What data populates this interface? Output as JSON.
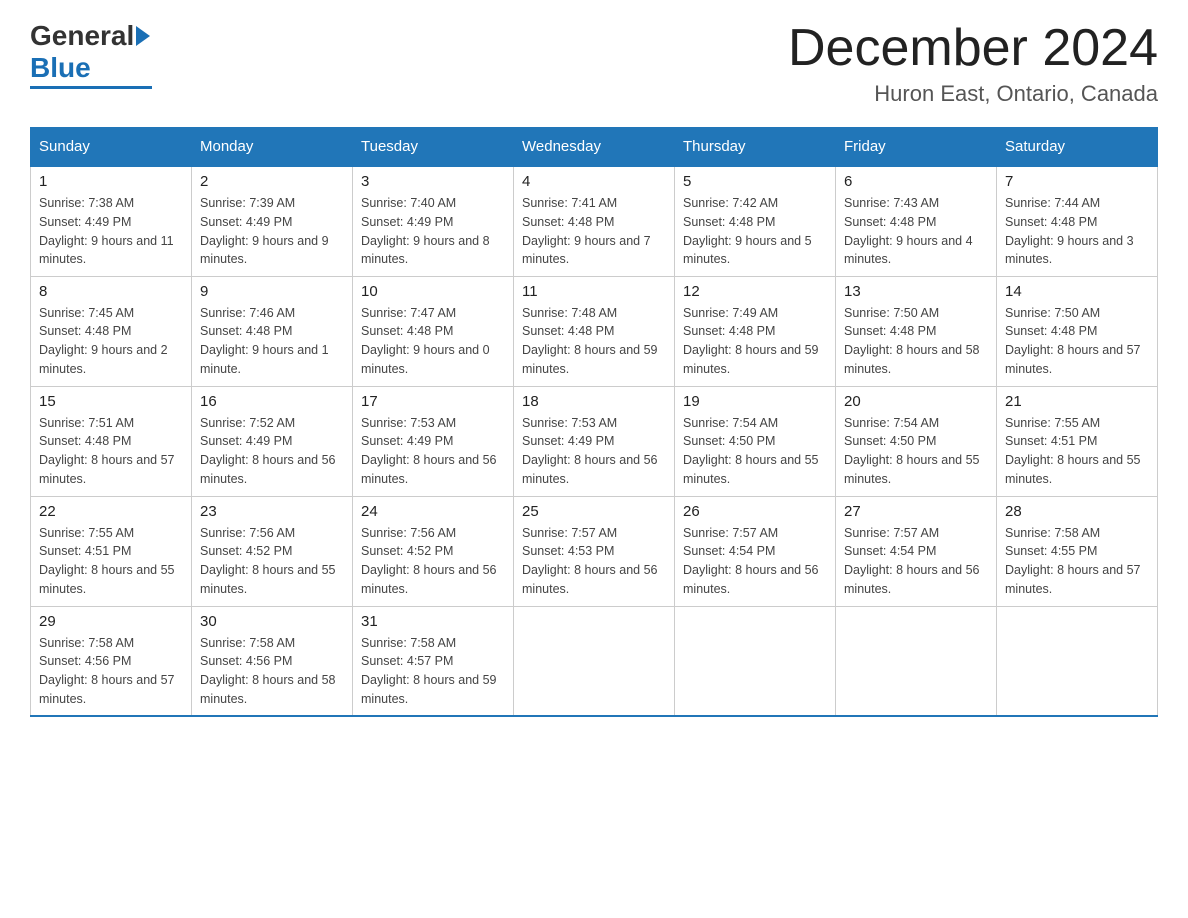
{
  "logo": {
    "general": "General",
    "blue": "Blue"
  },
  "header": {
    "month": "December 2024",
    "location": "Huron East, Ontario, Canada"
  },
  "weekdays": [
    "Sunday",
    "Monday",
    "Tuesday",
    "Wednesday",
    "Thursday",
    "Friday",
    "Saturday"
  ],
  "weeks": [
    [
      {
        "day": "1",
        "sunrise": "Sunrise: 7:38 AM",
        "sunset": "Sunset: 4:49 PM",
        "daylight": "Daylight: 9 hours and 11 minutes."
      },
      {
        "day": "2",
        "sunrise": "Sunrise: 7:39 AM",
        "sunset": "Sunset: 4:49 PM",
        "daylight": "Daylight: 9 hours and 9 minutes."
      },
      {
        "day": "3",
        "sunrise": "Sunrise: 7:40 AM",
        "sunset": "Sunset: 4:49 PM",
        "daylight": "Daylight: 9 hours and 8 minutes."
      },
      {
        "day": "4",
        "sunrise": "Sunrise: 7:41 AM",
        "sunset": "Sunset: 4:48 PM",
        "daylight": "Daylight: 9 hours and 7 minutes."
      },
      {
        "day": "5",
        "sunrise": "Sunrise: 7:42 AM",
        "sunset": "Sunset: 4:48 PM",
        "daylight": "Daylight: 9 hours and 5 minutes."
      },
      {
        "day": "6",
        "sunrise": "Sunrise: 7:43 AM",
        "sunset": "Sunset: 4:48 PM",
        "daylight": "Daylight: 9 hours and 4 minutes."
      },
      {
        "day": "7",
        "sunrise": "Sunrise: 7:44 AM",
        "sunset": "Sunset: 4:48 PM",
        "daylight": "Daylight: 9 hours and 3 minutes."
      }
    ],
    [
      {
        "day": "8",
        "sunrise": "Sunrise: 7:45 AM",
        "sunset": "Sunset: 4:48 PM",
        "daylight": "Daylight: 9 hours and 2 minutes."
      },
      {
        "day": "9",
        "sunrise": "Sunrise: 7:46 AM",
        "sunset": "Sunset: 4:48 PM",
        "daylight": "Daylight: 9 hours and 1 minute."
      },
      {
        "day": "10",
        "sunrise": "Sunrise: 7:47 AM",
        "sunset": "Sunset: 4:48 PM",
        "daylight": "Daylight: 9 hours and 0 minutes."
      },
      {
        "day": "11",
        "sunrise": "Sunrise: 7:48 AM",
        "sunset": "Sunset: 4:48 PM",
        "daylight": "Daylight: 8 hours and 59 minutes."
      },
      {
        "day": "12",
        "sunrise": "Sunrise: 7:49 AM",
        "sunset": "Sunset: 4:48 PM",
        "daylight": "Daylight: 8 hours and 59 minutes."
      },
      {
        "day": "13",
        "sunrise": "Sunrise: 7:50 AM",
        "sunset": "Sunset: 4:48 PM",
        "daylight": "Daylight: 8 hours and 58 minutes."
      },
      {
        "day": "14",
        "sunrise": "Sunrise: 7:50 AM",
        "sunset": "Sunset: 4:48 PM",
        "daylight": "Daylight: 8 hours and 57 minutes."
      }
    ],
    [
      {
        "day": "15",
        "sunrise": "Sunrise: 7:51 AM",
        "sunset": "Sunset: 4:48 PM",
        "daylight": "Daylight: 8 hours and 57 minutes."
      },
      {
        "day": "16",
        "sunrise": "Sunrise: 7:52 AM",
        "sunset": "Sunset: 4:49 PM",
        "daylight": "Daylight: 8 hours and 56 minutes."
      },
      {
        "day": "17",
        "sunrise": "Sunrise: 7:53 AM",
        "sunset": "Sunset: 4:49 PM",
        "daylight": "Daylight: 8 hours and 56 minutes."
      },
      {
        "day": "18",
        "sunrise": "Sunrise: 7:53 AM",
        "sunset": "Sunset: 4:49 PM",
        "daylight": "Daylight: 8 hours and 56 minutes."
      },
      {
        "day": "19",
        "sunrise": "Sunrise: 7:54 AM",
        "sunset": "Sunset: 4:50 PM",
        "daylight": "Daylight: 8 hours and 55 minutes."
      },
      {
        "day": "20",
        "sunrise": "Sunrise: 7:54 AM",
        "sunset": "Sunset: 4:50 PM",
        "daylight": "Daylight: 8 hours and 55 minutes."
      },
      {
        "day": "21",
        "sunrise": "Sunrise: 7:55 AM",
        "sunset": "Sunset: 4:51 PM",
        "daylight": "Daylight: 8 hours and 55 minutes."
      }
    ],
    [
      {
        "day": "22",
        "sunrise": "Sunrise: 7:55 AM",
        "sunset": "Sunset: 4:51 PM",
        "daylight": "Daylight: 8 hours and 55 minutes."
      },
      {
        "day": "23",
        "sunrise": "Sunrise: 7:56 AM",
        "sunset": "Sunset: 4:52 PM",
        "daylight": "Daylight: 8 hours and 55 minutes."
      },
      {
        "day": "24",
        "sunrise": "Sunrise: 7:56 AM",
        "sunset": "Sunset: 4:52 PM",
        "daylight": "Daylight: 8 hours and 56 minutes."
      },
      {
        "day": "25",
        "sunrise": "Sunrise: 7:57 AM",
        "sunset": "Sunset: 4:53 PM",
        "daylight": "Daylight: 8 hours and 56 minutes."
      },
      {
        "day": "26",
        "sunrise": "Sunrise: 7:57 AM",
        "sunset": "Sunset: 4:54 PM",
        "daylight": "Daylight: 8 hours and 56 minutes."
      },
      {
        "day": "27",
        "sunrise": "Sunrise: 7:57 AM",
        "sunset": "Sunset: 4:54 PM",
        "daylight": "Daylight: 8 hours and 56 minutes."
      },
      {
        "day": "28",
        "sunrise": "Sunrise: 7:58 AM",
        "sunset": "Sunset: 4:55 PM",
        "daylight": "Daylight: 8 hours and 57 minutes."
      }
    ],
    [
      {
        "day": "29",
        "sunrise": "Sunrise: 7:58 AM",
        "sunset": "Sunset: 4:56 PM",
        "daylight": "Daylight: 8 hours and 57 minutes."
      },
      {
        "day": "30",
        "sunrise": "Sunrise: 7:58 AM",
        "sunset": "Sunset: 4:56 PM",
        "daylight": "Daylight: 8 hours and 58 minutes."
      },
      {
        "day": "31",
        "sunrise": "Sunrise: 7:58 AM",
        "sunset": "Sunset: 4:57 PM",
        "daylight": "Daylight: 8 hours and 59 minutes."
      },
      null,
      null,
      null,
      null
    ]
  ]
}
